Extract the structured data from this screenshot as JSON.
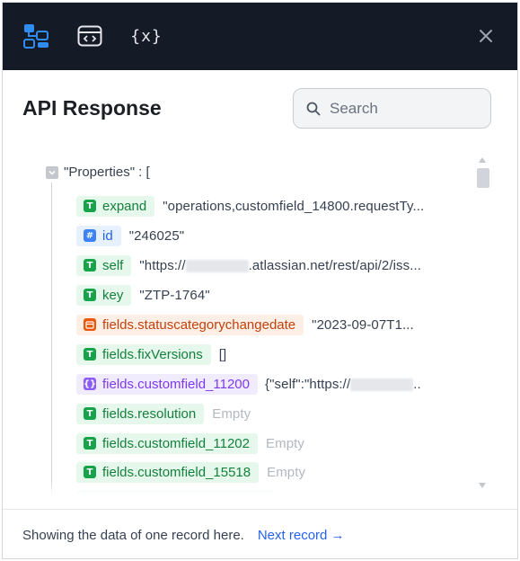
{
  "topbar": {
    "icons": [
      "mapping-icon",
      "code-view-icon",
      "variables-icon"
    ],
    "variables_label": "{x}",
    "close_icon": "close-icon"
  },
  "header": {
    "title": "API Response",
    "search_placeholder": "Search"
  },
  "tree": {
    "root_label": "\"Properties\" : [",
    "rows": [
      {
        "type": "text",
        "key": "expand",
        "value": "\"operations,customfield_14800.requestTy..."
      },
      {
        "type": "number",
        "key": "id",
        "value": "\"246025\""
      },
      {
        "type": "text",
        "key": "self",
        "value_prefix": "\"https://",
        "value_suffix": ".atlassian.net/rest/api/2/iss..."
      },
      {
        "type": "text",
        "key": "key",
        "value": "\"ZTP-1764\""
      },
      {
        "type": "date",
        "key": "fields.statuscategorychangedate",
        "value": "\"2023-09-07T1..."
      },
      {
        "type": "text",
        "key": "fields.fixVersions",
        "value": "[]"
      },
      {
        "type": "object",
        "key": "fields.customfield_11200",
        "value_prefix": "{\"self\":\"https://",
        "value_suffix": ".."
      },
      {
        "type": "text",
        "key": "fields.resolution",
        "value": "Empty"
      },
      {
        "type": "text",
        "key": "fields.customfield_11202",
        "value": "Empty"
      },
      {
        "type": "text",
        "key": "fields.customfield_15518",
        "value": "Empty"
      }
    ]
  },
  "footer": {
    "info": "Showing the data of one record here.",
    "next_label": "Next record →"
  },
  "colors": {
    "topbar_bg": "#141a26",
    "text_type": "#16a34a",
    "number_type": "#3b82f6",
    "date_type": "#ea580c",
    "object_type": "#8b5cf6",
    "link": "#2563eb"
  }
}
